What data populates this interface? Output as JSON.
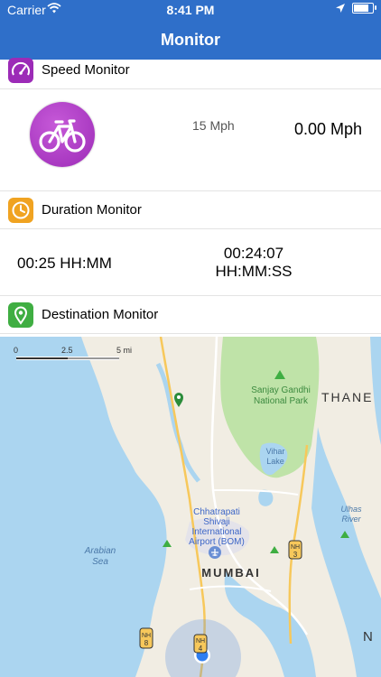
{
  "status_bar": {
    "carrier": "Carrier",
    "time": "8:41 PM",
    "battery_level": 0.85
  },
  "nav": {
    "title": "Monitor"
  },
  "speed": {
    "header": "Speed Monitor",
    "limit": "15 Mph",
    "current": "0.00 Mph",
    "icon": "bicycle-icon"
  },
  "duration": {
    "header": "Duration Monitor",
    "planned": "00:25 HH:MM",
    "elapsed_time": "00:24:07",
    "elapsed_unit": "HH:MM:SS",
    "icon": "clock-icon"
  },
  "destination": {
    "header": "Destination Monitor",
    "icon": "location-pin-icon"
  },
  "map": {
    "scale": [
      "0",
      "2.5",
      "5 mi"
    ],
    "park": [
      "Sanjay Gandhi",
      "National Park"
    ],
    "lake": [
      "Vihar",
      "Lake"
    ],
    "thane": "THANE",
    "airport": [
      "Chhatrapati",
      "Shivaji",
      "International",
      "Airport (BOM)"
    ],
    "sea": [
      "Arabian",
      "Sea"
    ],
    "city": "MUMBAI",
    "river": [
      "Ulhas",
      "River"
    ],
    "highways": [
      {
        "prefix": "NH",
        "number": "3"
      },
      {
        "prefix": "NH",
        "number": "8"
      },
      {
        "prefix": "NH",
        "number": "4"
      }
    ],
    "edge_letter": "N",
    "colors": {
      "water": "#abd5f0",
      "park": "#bfe3a8",
      "land": "#f1ede3",
      "road": "#f7c85b"
    }
  },
  "colors": {
    "nav": "#2f6fc9",
    "speed_icon": "#9c2bb7",
    "duration_icon": "#f0a321",
    "destination_icon": "#3fae42"
  }
}
